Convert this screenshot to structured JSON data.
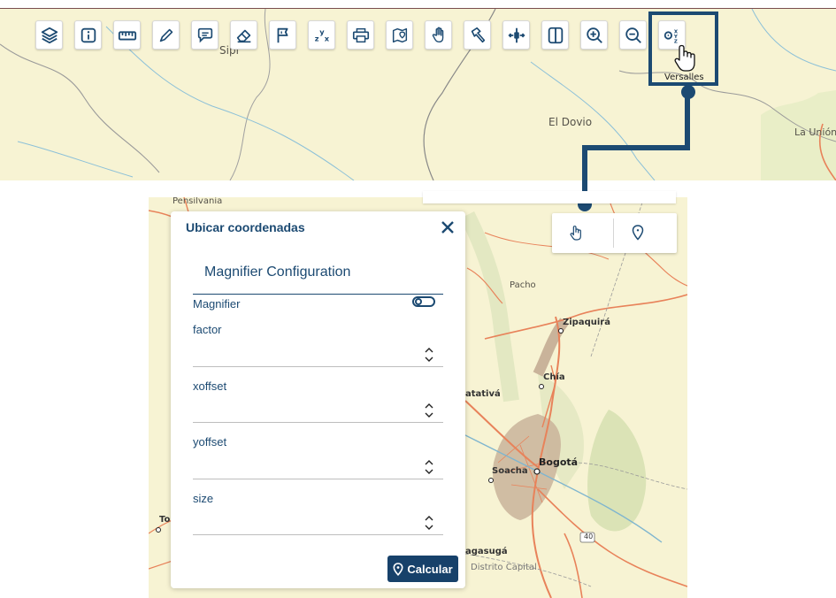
{
  "map_top": {
    "places": [
      {
        "key": "sipi",
        "label": "Sipí"
      },
      {
        "key": "el_dovio",
        "label": "El Dovio"
      },
      {
        "key": "la_union",
        "label": "La Unión"
      }
    ]
  },
  "toolbar": {
    "tools": [
      {
        "name": "layers-icon"
      },
      {
        "name": "info-icon"
      },
      {
        "name": "ruler-icon"
      },
      {
        "name": "pencil-icon"
      },
      {
        "name": "comment-icon"
      },
      {
        "name": "eraser-icon"
      },
      {
        "name": "flag-icon"
      },
      {
        "name": "xyz-coordinates-icon"
      },
      {
        "name": "print-icon"
      },
      {
        "name": "map-pin-icon"
      },
      {
        "name": "pan-hand-icon"
      },
      {
        "name": "hammer-icon"
      },
      {
        "name": "swipe-icon"
      },
      {
        "name": "split-view-icon"
      },
      {
        "name": "zoom-in-icon"
      },
      {
        "name": "zoom-out-icon"
      },
      {
        "name": "locate-coordinates-icon"
      }
    ],
    "highlight_caption": "Versalles"
  },
  "map_bottom": {
    "places": [
      {
        "key": "pensilvania",
        "label": "Pensilvania"
      },
      {
        "key": "pacho",
        "label": "Pacho"
      },
      {
        "key": "zipaquira",
        "label": "Zipaquirá"
      },
      {
        "key": "chia",
        "label": "Chía"
      },
      {
        "key": "facatativa",
        "label": "atativá"
      },
      {
        "key": "bogota",
        "label": "Bogotá"
      },
      {
        "key": "soacha",
        "label": "Soacha"
      },
      {
        "key": "fusagasuga",
        "label": "agasugá"
      },
      {
        "key": "distrito_capital",
        "label": "Distrito Capital"
      },
      {
        "key": "to",
        "label": "To"
      },
      {
        "key": "route40",
        "label": "40"
      }
    ],
    "tools": [
      {
        "name": "pan-hand-icon"
      },
      {
        "name": "map-pin-icon"
      }
    ]
  },
  "panel": {
    "title": "Ubicar coordenadas",
    "config_title": "Magnifier Configuration",
    "magnifier_label": "Magnifier",
    "magnifier_enabled": false,
    "fields": [
      {
        "key": "factor",
        "label": "factor",
        "value": ""
      },
      {
        "key": "xoffset",
        "label": "xoffset",
        "value": ""
      },
      {
        "key": "yoffset",
        "label": "yoffset",
        "value": ""
      },
      {
        "key": "size",
        "label": "size",
        "value": ""
      }
    ],
    "submit_label": "Calcular"
  },
  "colors": {
    "accent": "#1c4a72",
    "button": "#17416a",
    "map_base": "#f7f3d3",
    "road": "#e8825a",
    "river": "#7fb5cf",
    "urban": "#c9b39a",
    "forest": "#d7e1b3"
  }
}
